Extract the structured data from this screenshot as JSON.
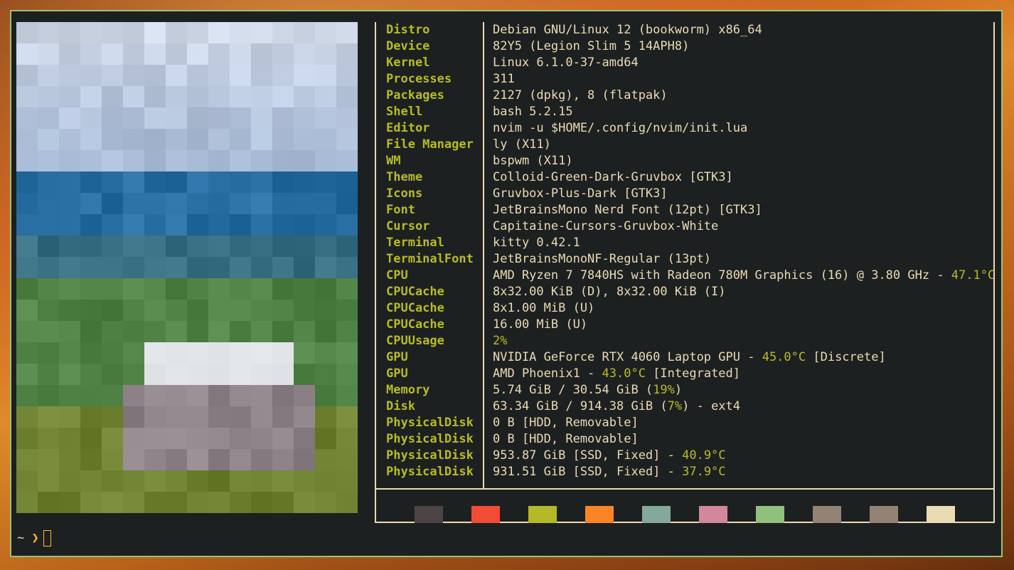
{
  "info": [
    {
      "key": "Distro",
      "parts": [
        {
          "text": "Debian GNU/Linux 12 (bookworm) x86_64"
        }
      ]
    },
    {
      "key": "Device",
      "parts": [
        {
          "text": "82Y5 (Legion Slim 5 14APH8)"
        }
      ]
    },
    {
      "key": "Kernel",
      "parts": [
        {
          "text": "Linux 6.1.0-37-amd64"
        }
      ]
    },
    {
      "key": "Processes",
      "parts": [
        {
          "text": "311"
        }
      ]
    },
    {
      "key": "Packages",
      "parts": [
        {
          "text": "2127 (dpkg), 8 (flatpak)"
        }
      ]
    },
    {
      "key": "Shell",
      "parts": [
        {
          "text": "bash 5.2.15"
        }
      ]
    },
    {
      "key": "Editor",
      "parts": [
        {
          "text": "nvim -u $HOME/.config/nvim/init.lua"
        }
      ]
    },
    {
      "key": "File Manager",
      "parts": [
        {
          "text": "ly (X11)"
        }
      ]
    },
    {
      "key": "WM",
      "parts": [
        {
          "text": "bspwm (X11)"
        }
      ]
    },
    {
      "key": "Theme",
      "parts": [
        {
          "text": "Colloid-Green-Dark-Gruvbox [GTK3]"
        }
      ]
    },
    {
      "key": "Icons",
      "parts": [
        {
          "text": "Gruvbox-Plus-Dark [GTK3]"
        }
      ]
    },
    {
      "key": "Font",
      "parts": [
        {
          "text": "JetBrainsMono Nerd Font (12pt) [GTK3]"
        }
      ]
    },
    {
      "key": "Cursor",
      "parts": [
        {
          "text": "Capitaine-Cursors-Gruvbox-White"
        }
      ]
    },
    {
      "key": "Terminal",
      "parts": [
        {
          "text": "kitty 0.42.1"
        }
      ]
    },
    {
      "key": "TerminalFont",
      "parts": [
        {
          "text": "JetBrainsMonoNF-Regular (13pt)"
        }
      ]
    },
    {
      "key": "CPU",
      "parts": [
        {
          "text": "AMD Ryzen 7 7840HS with Radeon 780M Graphics (16) @ 3.80 GHz - "
        },
        {
          "text": "47.1°C",
          "hl": true
        }
      ]
    },
    {
      "key": "CPUCache",
      "parts": [
        {
          "text": "8x32.00 KiB (D), 8x32.00 KiB (I)"
        }
      ]
    },
    {
      "key": "CPUCache",
      "parts": [
        {
          "text": "8x1.00 MiB (U)"
        }
      ]
    },
    {
      "key": "CPUCache",
      "parts": [
        {
          "text": "16.00 MiB (U)"
        }
      ]
    },
    {
      "key": "CPUUsage",
      "parts": [
        {
          "text": "2%",
          "hl": true
        }
      ]
    },
    {
      "key": "GPU",
      "parts": [
        {
          "text": "NVIDIA GeForce RTX 4060 Laptop GPU - "
        },
        {
          "text": "45.0°C",
          "hl": true
        },
        {
          "text": " [Discrete]"
        }
      ]
    },
    {
      "key": "GPU",
      "parts": [
        {
          "text": "AMD Phoenix1 - "
        },
        {
          "text": "43.0°C",
          "hl": true
        },
        {
          "text": " [Integrated]"
        }
      ]
    },
    {
      "key": "Memory",
      "parts": [
        {
          "text": "5.74 GiB / 30.54 GiB ("
        },
        {
          "text": "19%",
          "hl": true
        },
        {
          "text": ")"
        }
      ]
    },
    {
      "key": "Disk",
      "parts": [
        {
          "text": "63.34 GiB / 914.38 GiB ("
        },
        {
          "text": "7%",
          "hl": true
        },
        {
          "text": ") - ext4"
        }
      ]
    },
    {
      "key": "PhysicalDisk",
      "parts": [
        {
          "text": "0 B [HDD, Removable]"
        }
      ]
    },
    {
      "key": "PhysicalDisk",
      "parts": [
        {
          "text": "0 B [HDD, Removable]"
        }
      ]
    },
    {
      "key": "PhysicalDisk",
      "parts": [
        {
          "text": "953.87 GiB [SSD, Fixed] - "
        },
        {
          "text": "40.9°C",
          "hl": true
        }
      ]
    },
    {
      "key": "PhysicalDisk",
      "parts": [
        {
          "text": "931.51 GiB [SSD, Fixed] - "
        },
        {
          "text": "37.9°C",
          "hl": true
        }
      ]
    }
  ],
  "palette": [
    "#4d4545",
    "#f14c35",
    "#b5b926",
    "#fb8524",
    "#84a89a",
    "#d3879b",
    "#8fc17c",
    "#928374",
    "#928374",
    "#ebdbb2"
  ],
  "colors": {
    "key": "#b8bb26",
    "value": "#ebdbb2",
    "border": "#98c379",
    "background": "#1d2021"
  },
  "prompt": {
    "dir": "~",
    "arrow": "❯"
  }
}
